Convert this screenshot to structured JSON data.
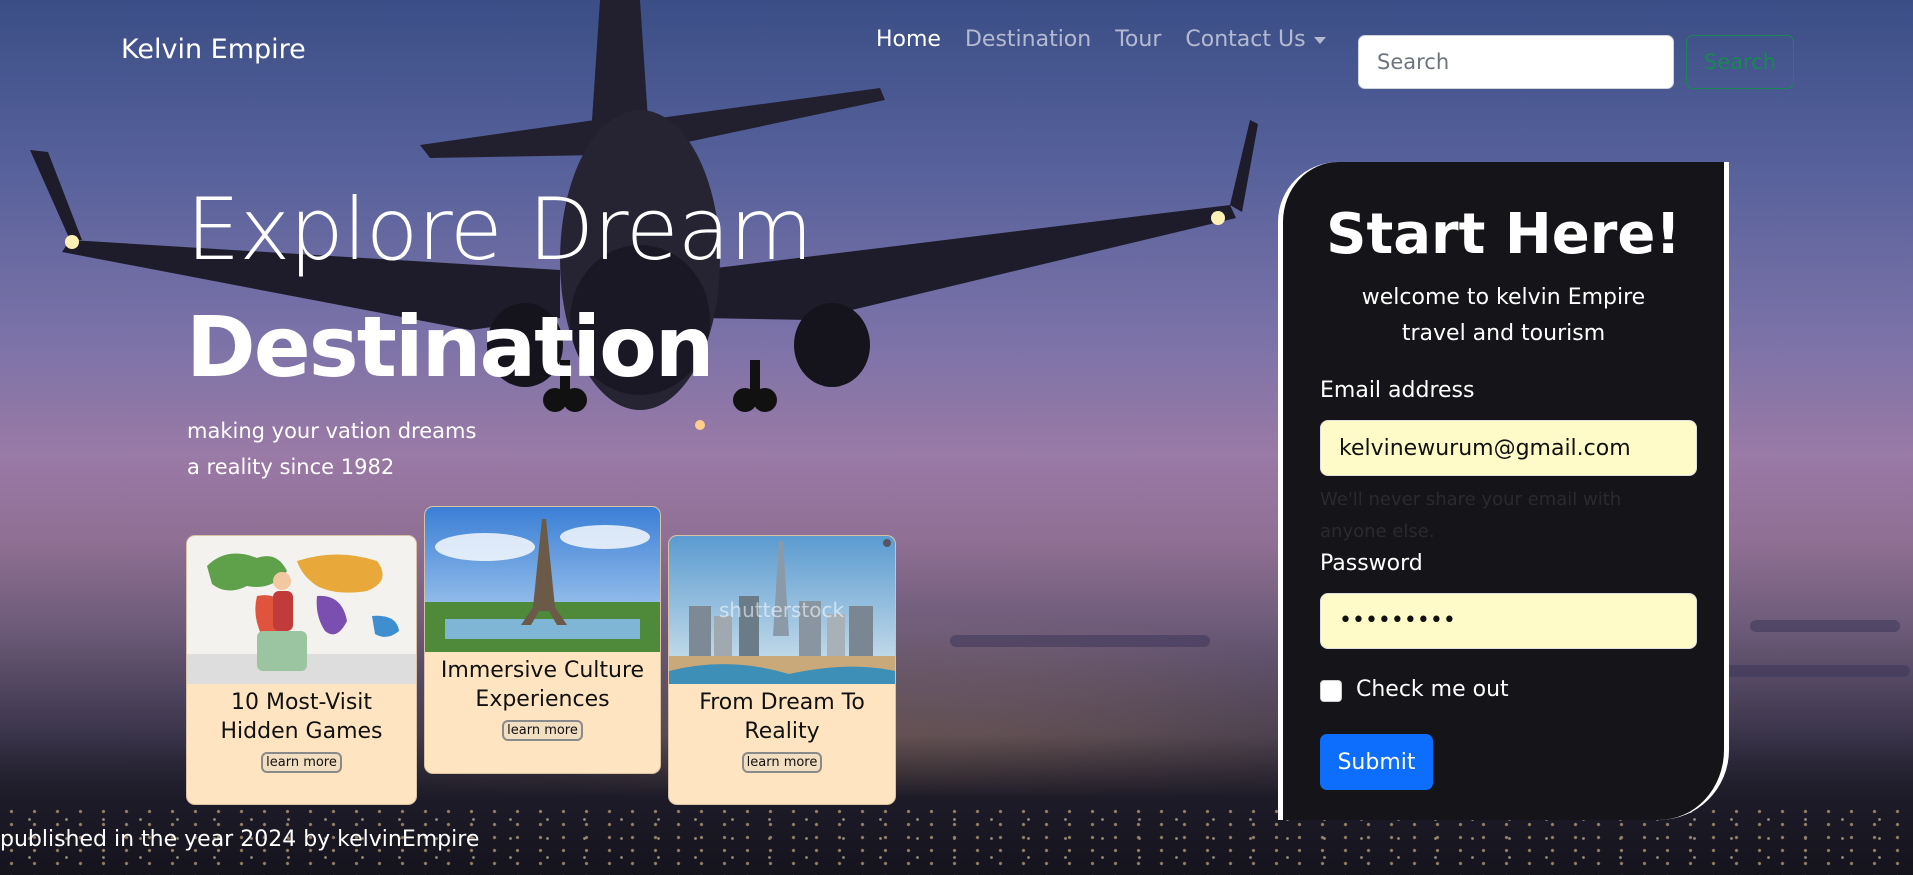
{
  "navbar": {
    "brand": "Kelvin Empire",
    "items": [
      {
        "label": "Home",
        "active": true
      },
      {
        "label": "Destination",
        "active": false
      },
      {
        "label": "Tour",
        "active": false
      },
      {
        "label": "Contact Us",
        "active": false,
        "dropdown": true
      }
    ],
    "search_placeholder": "Search",
    "search_button": "Search"
  },
  "hero": {
    "title_line1": "Explore Dream",
    "title_line2": "Destination",
    "tagline_line1": "making your vation dreams",
    "tagline_line2": "a reality since 1982"
  },
  "cards": [
    {
      "title_line1": "10 Most-Visit",
      "title_line2": "Hidden Games",
      "button": "learn more"
    },
    {
      "title_line1": "Immersive Culture",
      "title_line2": "Experiences",
      "button": "learn more"
    },
    {
      "title_line1": "From Dream To",
      "title_line2": "Reality",
      "button": "learn more",
      "watermark": "shutterstock"
    }
  ],
  "form": {
    "title": "Start Here!",
    "subtitle_line1": "welcome to kelvin Empire",
    "subtitle_line2": "travel and tourism",
    "email_label": "Email address",
    "email_value": "kelvinewurum@gmail.com",
    "email_help_line1": "We'll never share your email with",
    "email_help_line2": "anyone else.",
    "password_label": "Password",
    "password_value": "•••••••••",
    "checkbox_label": "Check me out",
    "submit_label": "Submit"
  },
  "footer": {
    "text": "published in the year 2024 by kelvinEmpire"
  },
  "colors": {
    "accent": "#0d6efd",
    "search_btn": "#198754",
    "card_bg": "#ffe4c1",
    "input_bg": "#fffbc8",
    "panel_bg": "#151418"
  }
}
